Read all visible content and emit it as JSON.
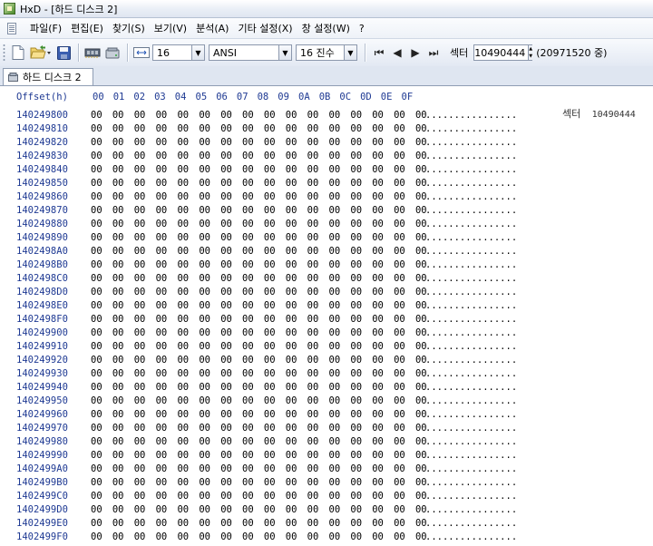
{
  "window": {
    "title": "HxD - [하드 디스크 2]"
  },
  "menu": [
    "파일(F)",
    "편집(E)",
    "찾기(S)",
    "보기(V)",
    "분석(A)",
    "기타 설정(X)",
    "창 설정(W)",
    "?"
  ],
  "toolbar": {
    "bytes_per_row": "16",
    "charset": "ANSI",
    "offset_base": "16 진수",
    "sector_label": "섹터",
    "sector_value": "10490444",
    "sector_total": "(20971520 중)"
  },
  "tab": {
    "label": "하드 디스크 2"
  },
  "hex": {
    "offset_header": "Offset(h)",
    "columns": [
      "00",
      "01",
      "02",
      "03",
      "04",
      "05",
      "06",
      "07",
      "08",
      "09",
      "0A",
      "0B",
      "0C",
      "0D",
      "0E",
      "0F"
    ],
    "sector_info_label": "섹터",
    "sector_info_value": "10490444",
    "rows": [
      {
        "offset": "140249800",
        "bytes": "00 00 00 00 00 00 00 00 00 00 00 00 00 00 00 00",
        "ascii": "................"
      },
      {
        "offset": "140249810",
        "bytes": "00 00 00 00 00 00 00 00 00 00 00 00 00 00 00 00",
        "ascii": "................"
      },
      {
        "offset": "140249820",
        "bytes": "00 00 00 00 00 00 00 00 00 00 00 00 00 00 00 00",
        "ascii": "................"
      },
      {
        "offset": "140249830",
        "bytes": "00 00 00 00 00 00 00 00 00 00 00 00 00 00 00 00",
        "ascii": "................"
      },
      {
        "offset": "140249840",
        "bytes": "00 00 00 00 00 00 00 00 00 00 00 00 00 00 00 00",
        "ascii": "................"
      },
      {
        "offset": "140249850",
        "bytes": "00 00 00 00 00 00 00 00 00 00 00 00 00 00 00 00",
        "ascii": "................"
      },
      {
        "offset": "140249860",
        "bytes": "00 00 00 00 00 00 00 00 00 00 00 00 00 00 00 00",
        "ascii": "................"
      },
      {
        "offset": "140249870",
        "bytes": "00 00 00 00 00 00 00 00 00 00 00 00 00 00 00 00",
        "ascii": "................"
      },
      {
        "offset": "140249880",
        "bytes": "00 00 00 00 00 00 00 00 00 00 00 00 00 00 00 00",
        "ascii": "................"
      },
      {
        "offset": "140249890",
        "bytes": "00 00 00 00 00 00 00 00 00 00 00 00 00 00 00 00",
        "ascii": "................"
      },
      {
        "offset": "1402498A0",
        "bytes": "00 00 00 00 00 00 00 00 00 00 00 00 00 00 00 00",
        "ascii": "................"
      },
      {
        "offset": "1402498B0",
        "bytes": "00 00 00 00 00 00 00 00 00 00 00 00 00 00 00 00",
        "ascii": "................"
      },
      {
        "offset": "1402498C0",
        "bytes": "00 00 00 00 00 00 00 00 00 00 00 00 00 00 00 00",
        "ascii": "................"
      },
      {
        "offset": "1402498D0",
        "bytes": "00 00 00 00 00 00 00 00 00 00 00 00 00 00 00 00",
        "ascii": "................"
      },
      {
        "offset": "1402498E0",
        "bytes": "00 00 00 00 00 00 00 00 00 00 00 00 00 00 00 00",
        "ascii": "................"
      },
      {
        "offset": "1402498F0",
        "bytes": "00 00 00 00 00 00 00 00 00 00 00 00 00 00 00 00",
        "ascii": "................"
      },
      {
        "offset": "140249900",
        "bytes": "00 00 00 00 00 00 00 00 00 00 00 00 00 00 00 00",
        "ascii": "................"
      },
      {
        "offset": "140249910",
        "bytes": "00 00 00 00 00 00 00 00 00 00 00 00 00 00 00 00",
        "ascii": "................"
      },
      {
        "offset": "140249920",
        "bytes": "00 00 00 00 00 00 00 00 00 00 00 00 00 00 00 00",
        "ascii": "................"
      },
      {
        "offset": "140249930",
        "bytes": "00 00 00 00 00 00 00 00 00 00 00 00 00 00 00 00",
        "ascii": "................"
      },
      {
        "offset": "140249940",
        "bytes": "00 00 00 00 00 00 00 00 00 00 00 00 00 00 00 00",
        "ascii": "................"
      },
      {
        "offset": "140249950",
        "bytes": "00 00 00 00 00 00 00 00 00 00 00 00 00 00 00 00",
        "ascii": "................"
      },
      {
        "offset": "140249960",
        "bytes": "00 00 00 00 00 00 00 00 00 00 00 00 00 00 00 00",
        "ascii": "................"
      },
      {
        "offset": "140249970",
        "bytes": "00 00 00 00 00 00 00 00 00 00 00 00 00 00 00 00",
        "ascii": "................"
      },
      {
        "offset": "140249980",
        "bytes": "00 00 00 00 00 00 00 00 00 00 00 00 00 00 00 00",
        "ascii": "................"
      },
      {
        "offset": "140249990",
        "bytes": "00 00 00 00 00 00 00 00 00 00 00 00 00 00 00 00",
        "ascii": "................"
      },
      {
        "offset": "1402499A0",
        "bytes": "00 00 00 00 00 00 00 00 00 00 00 00 00 00 00 00",
        "ascii": "................"
      },
      {
        "offset": "1402499B0",
        "bytes": "00 00 00 00 00 00 00 00 00 00 00 00 00 00 00 00",
        "ascii": "................"
      },
      {
        "offset": "1402499C0",
        "bytes": "00 00 00 00 00 00 00 00 00 00 00 00 00 00 00 00",
        "ascii": "................"
      },
      {
        "offset": "1402499D0",
        "bytes": "00 00 00 00 00 00 00 00 00 00 00 00 00 00 00 00",
        "ascii": "................"
      },
      {
        "offset": "1402499E0",
        "bytes": "00 00 00 00 00 00 00 00 00 00 00 00 00 00 00 00",
        "ascii": "................"
      },
      {
        "offset": "1402499F0",
        "bytes": "00 00 00 00 00 00 00 00 00 00 00 00 00 00 00 00",
        "ascii": "................"
      }
    ]
  }
}
